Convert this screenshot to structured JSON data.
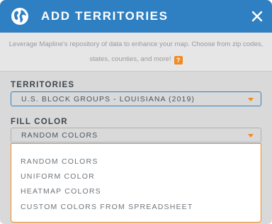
{
  "header": {
    "title": "ADD TERRITORIES",
    "icon": "globe-icon",
    "close_icon": "close-icon",
    "background_color": "#2f80c3"
  },
  "intro": {
    "line1": "Leverage Mapline's repository of data to enhance your map. Choose from zip codes,",
    "line2": "states, counties, and more!",
    "help_label": "?",
    "help_color": "#f08a24"
  },
  "territories": {
    "label": "TERRITORIES",
    "selected": "U.S. BLOCK GROUPS - LOUISIANA (2019)"
  },
  "fill_color": {
    "label": "FILL COLOR",
    "selected": "RANDOM COLORS",
    "options": [
      "RANDOM COLORS",
      "UNIFORM COLOR",
      "HEATMAP COLORS",
      "CUSTOM COLORS FROM SPREADSHEET"
    ]
  },
  "accent_color": "#f08a24"
}
